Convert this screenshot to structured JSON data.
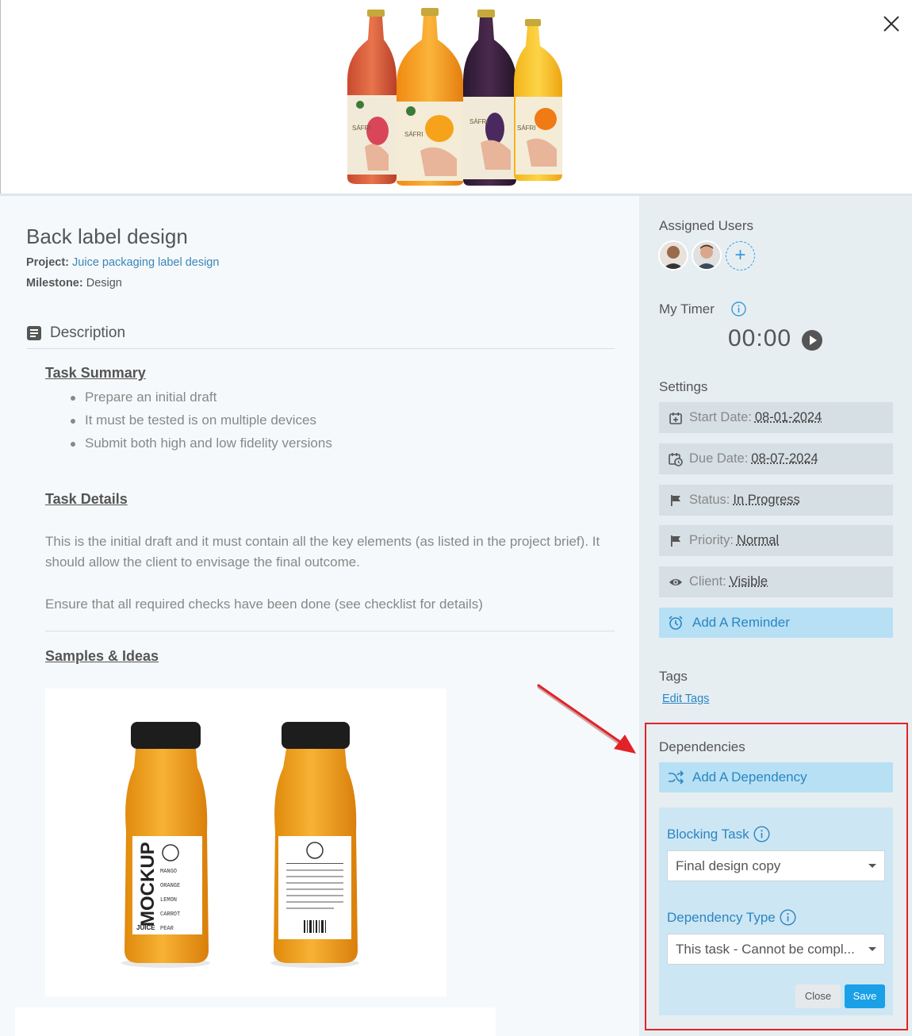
{
  "task": {
    "title": "Back label design",
    "project_label": "Project:",
    "project_value": "Juice packaging label design",
    "milestone_label": "Milestone:",
    "milestone_value": "Design"
  },
  "description": {
    "heading": "Description",
    "summary_heading": "Task Summary",
    "bullets": [
      "Prepare an initial draft",
      "It must be tested is on multiple devices",
      "Submit both high and low fidelity versions"
    ],
    "details_heading": "Task Details",
    "details_paragraph_1": "This is the initial draft and it must contain all the key elements (as listed in the project brief). It should allow the client to envisage the final outcome.",
    "details_paragraph_2": "Ensure that all required checks have been done (see checklist for details)",
    "samples_heading": "Samples & Ideas"
  },
  "sample_image": {
    "bottle_front_word": "MOCKUP",
    "bottle_front_small": "JUICE",
    "flavors": [
      "MANGO",
      "ORANGE",
      "LEMON",
      "CARROT",
      "PEAR"
    ],
    "hero_brand": "SÁFRI"
  },
  "sidebar": {
    "assigned_users_heading": "Assigned Users",
    "add_user_symbol": "+",
    "timer_heading": "My Timer",
    "timer_value": "00:00",
    "settings_heading": "Settings",
    "start_label": "Start Date:",
    "start_value": "08-01-2024",
    "due_label": "Due Date:",
    "due_value": "08-07-2024",
    "status_label": "Status:",
    "status_value": "In Progress",
    "priority_label": "Priority:",
    "priority_value": "Normal",
    "client_label": "Client:",
    "client_value": "Visible",
    "reminder_label": "Add A Reminder",
    "tags_heading": "Tags",
    "edit_tags_label": "Edit Tags",
    "dependencies_heading": "Dependencies",
    "add_dependency_label": "Add A Dependency",
    "blocking_task_label": "Blocking Task",
    "blocking_task_value": "Final design copy",
    "dependency_type_label": "Dependency Type",
    "dependency_type_value": "This task - Cannot be compl...",
    "close_label": "Close",
    "save_label": "Save"
  },
  "colors": {
    "accent": "#2a86c3",
    "save_button": "#1aa0e6",
    "highlight_box": "#e32227",
    "sidebar_bg": "#e6eef2",
    "setting_bg": "#d6dfe4",
    "action_bg": "#b7e0f5"
  },
  "icons": [
    "close-icon",
    "description-icon",
    "add-user-icon",
    "info-icon",
    "play-icon",
    "calendar-plus-icon",
    "calendar-clock-icon",
    "flag-icon",
    "eye-icon",
    "alarm-icon",
    "shuffle-icon",
    "chevron-down-icon"
  ]
}
